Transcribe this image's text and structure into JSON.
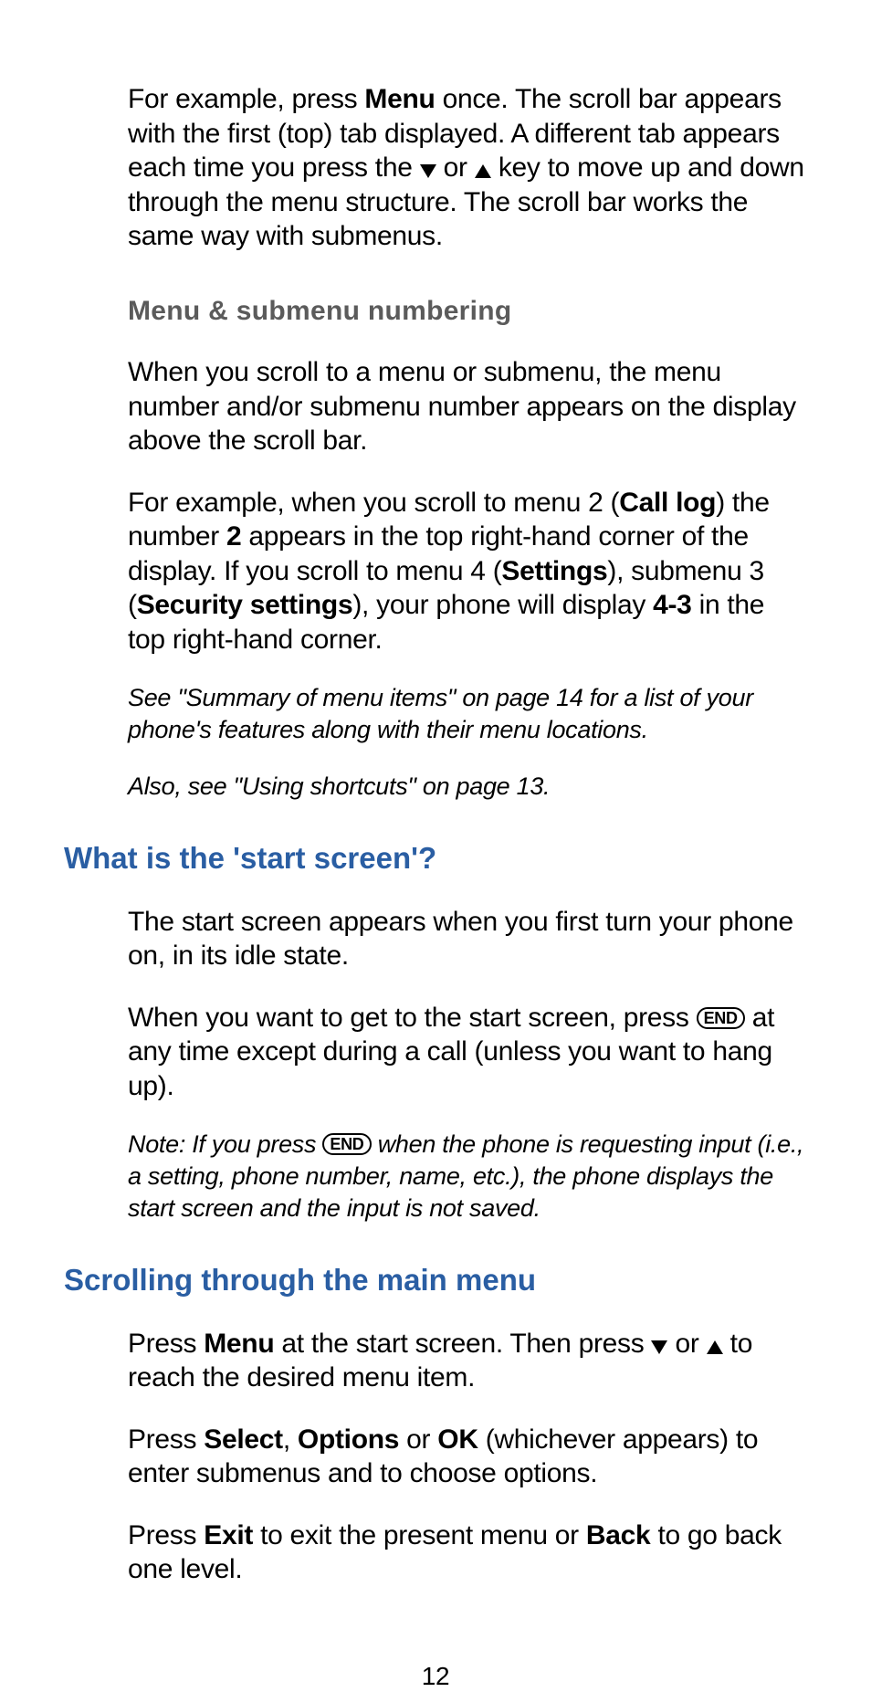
{
  "page_number": "12",
  "para1": {
    "a": "For example, press ",
    "menu": "Menu",
    "b": " once. The scroll bar appears with the first (top) tab displayed. A different tab appears each time you press the ",
    "c": " or ",
    "d": " key to move up and down through the menu structure. The scroll bar works the same way with submenus."
  },
  "sub1": "Menu & submenu numbering",
  "para2": "When you scroll to a menu or submenu, the menu number and/or submenu number appears on the display above the scroll bar.",
  "para3": {
    "a": "For example, when you scroll to menu 2 (",
    "calllog": "Call log",
    "b": ") the number ",
    "two": "2",
    "c": " appears in the top right-hand corner of the display. If you scroll to menu 4 (",
    "settings": "Settings",
    "d": "), submenu 3 (",
    "security": "Security settings",
    "e": "), your phone will display ",
    "fourthree": "4-3",
    "f": " in the top right-hand corner."
  },
  "note1": "See \"Summary of menu items\" on page 14 for a list of your phone's features along with their menu locations.",
  "note2": "Also, see \"Using shortcuts\" on page 13.",
  "h2a": "What is the 'start screen'?",
  "para4": "The start screen appears when you first turn your phone on, in its idle state.",
  "para5": {
    "a": "When you want to get to the start screen, press ",
    "end": "END",
    "b": " at any time except during a call (unless you want to hang up)."
  },
  "note3": {
    "a": "Note: If you press ",
    "end": "END",
    "b": " when the phone is requesting input (i.e., a setting, phone number, name, etc.), the phone displays the start screen and the input is not saved."
  },
  "h2b": "Scrolling through the main menu",
  "para6": {
    "a": "Press ",
    "menu": "Menu",
    "b": " at the start screen. Then press ",
    "c": " or ",
    "d": " to reach the desired menu item."
  },
  "para7": {
    "a": "Press ",
    "select": "Select",
    "b": ", ",
    "options": "Options",
    "c": " or ",
    "ok": "OK",
    "d": " (whichever appears) to enter submenus and to choose options."
  },
  "para8": {
    "a": "Press ",
    "exit": "Exit",
    "b": " to exit the present menu or ",
    "back": "Back",
    "c": " to go back one level."
  }
}
